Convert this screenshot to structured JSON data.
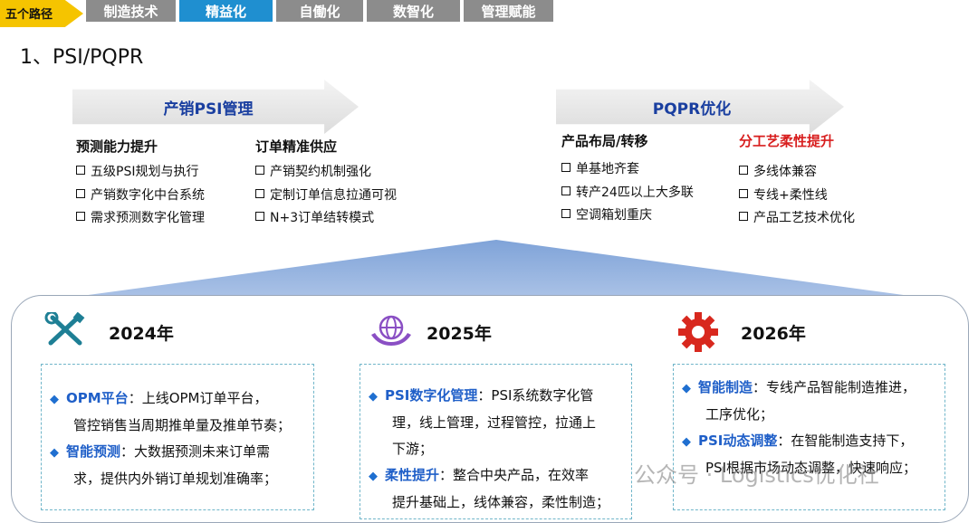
{
  "tabs": {
    "first": "五个路径",
    "items": [
      "制造技术",
      "精益化",
      "自働化",
      "数智化",
      "管理赋能"
    ],
    "active_index": 1
  },
  "section_title": "1、PSI/PQPR",
  "banners": {
    "left": "产销PSI管理",
    "right": "PQPR优化"
  },
  "columns": [
    {
      "heading": "预测能力提升",
      "items": [
        "五级PSI规划与执行",
        "产销数字化中台系统",
        "需求预测数字化管理"
      ]
    },
    {
      "heading": "订单精准供应",
      "items": [
        "产销契约机制强化",
        "定制订单信息拉通可视",
        "N+3订单结转模式"
      ]
    },
    {
      "heading": "产品布局/转移",
      "items": [
        "单基地齐套",
        "转产24匹以上大多联",
        "空调箱划重庆"
      ]
    },
    {
      "heading": "分工艺柔性提升",
      "items": [
        "多线体兼容",
        "专线+柔性线",
        "产品工艺技术优化"
      ]
    }
  ],
  "years": [
    {
      "year": "2024年",
      "icon": "tools-icon",
      "paras": [
        {
          "kw": "OPM平台",
          "sep": "：",
          "line1": "上线OPM订单平台，",
          "rest": [
            "管控销售当周期推单量及推单节奏；"
          ]
        },
        {
          "kw": "智能预测",
          "sep": "：",
          "line1": "大数据预测未来订单需",
          "rest": [
            "求，提供内外销订单规划准确率；"
          ]
        }
      ]
    },
    {
      "year": "2025年",
      "icon": "globe-hands-icon",
      "paras": [
        {
          "kw": "PSI数字化管理",
          "sep": "：",
          "line1": "PSI系统数字化管",
          "rest": [
            "理，线上管理，过程管控，拉通上",
            "下游；"
          ]
        },
        {
          "kw": "柔性提升",
          "sep": "：",
          "line1": "整合中央产品，在效率",
          "rest": [
            "提升基础上，线体兼容，柔性制造；"
          ]
        }
      ]
    },
    {
      "year": "2026年",
      "icon": "gear-icon",
      "paras": [
        {
          "kw": "智能制造",
          "sep": "：",
          "line1": "专线产品智能制造推进，",
          "rest": [
            "工序优化；"
          ]
        },
        {
          "kw": "PSI动态调整",
          "sep": "：",
          "line1": "在智能制造支持下，",
          "rest": [
            "PSI根据市场动态调整，快速响应；"
          ]
        }
      ]
    }
  ],
  "bullet_symbol": "◆",
  "watermark": "公众号 · Logistics优化社",
  "colors": {
    "tab_active": "#1f8fd0",
    "tab_inactive": "#8c8c8c",
    "tab_first": "#f5c400",
    "banner_text": "#1a3fa0",
    "keyword": "#1f5fc8",
    "red_heading": "#d81e1e",
    "pyramid": "#8fb0dc",
    "icon_teal": "#1e7f95",
    "icon_purple": "#8a4fc4",
    "icon_red": "#d8281e"
  }
}
